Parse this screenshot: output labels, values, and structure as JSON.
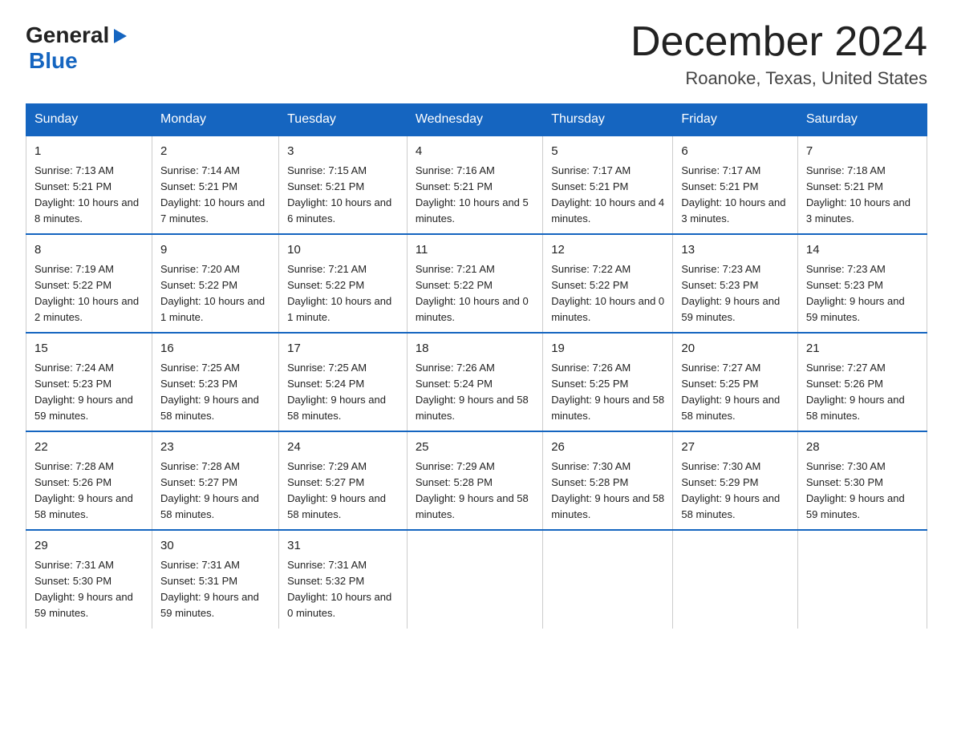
{
  "header": {
    "logo_line1": "General",
    "logo_line2": "Blue",
    "title": "December 2024",
    "subtitle": "Roanoke, Texas, United States"
  },
  "calendar": {
    "days_of_week": [
      "Sunday",
      "Monday",
      "Tuesday",
      "Wednesday",
      "Thursday",
      "Friday",
      "Saturday"
    ],
    "weeks": [
      [
        {
          "day": "1",
          "sunrise": "7:13 AM",
          "sunset": "5:21 PM",
          "daylight": "10 hours and 8 minutes."
        },
        {
          "day": "2",
          "sunrise": "7:14 AM",
          "sunset": "5:21 PM",
          "daylight": "10 hours and 7 minutes."
        },
        {
          "day": "3",
          "sunrise": "7:15 AM",
          "sunset": "5:21 PM",
          "daylight": "10 hours and 6 minutes."
        },
        {
          "day": "4",
          "sunrise": "7:16 AM",
          "sunset": "5:21 PM",
          "daylight": "10 hours and 5 minutes."
        },
        {
          "day": "5",
          "sunrise": "7:17 AM",
          "sunset": "5:21 PM",
          "daylight": "10 hours and 4 minutes."
        },
        {
          "day": "6",
          "sunrise": "7:17 AM",
          "sunset": "5:21 PM",
          "daylight": "10 hours and 3 minutes."
        },
        {
          "day": "7",
          "sunrise": "7:18 AM",
          "sunset": "5:21 PM",
          "daylight": "10 hours and 3 minutes."
        }
      ],
      [
        {
          "day": "8",
          "sunrise": "7:19 AM",
          "sunset": "5:22 PM",
          "daylight": "10 hours and 2 minutes."
        },
        {
          "day": "9",
          "sunrise": "7:20 AM",
          "sunset": "5:22 PM",
          "daylight": "10 hours and 1 minute."
        },
        {
          "day": "10",
          "sunrise": "7:21 AM",
          "sunset": "5:22 PM",
          "daylight": "10 hours and 1 minute."
        },
        {
          "day": "11",
          "sunrise": "7:21 AM",
          "sunset": "5:22 PM",
          "daylight": "10 hours and 0 minutes."
        },
        {
          "day": "12",
          "sunrise": "7:22 AM",
          "sunset": "5:22 PM",
          "daylight": "10 hours and 0 minutes."
        },
        {
          "day": "13",
          "sunrise": "7:23 AM",
          "sunset": "5:23 PM",
          "daylight": "9 hours and 59 minutes."
        },
        {
          "day": "14",
          "sunrise": "7:23 AM",
          "sunset": "5:23 PM",
          "daylight": "9 hours and 59 minutes."
        }
      ],
      [
        {
          "day": "15",
          "sunrise": "7:24 AM",
          "sunset": "5:23 PM",
          "daylight": "9 hours and 59 minutes."
        },
        {
          "day": "16",
          "sunrise": "7:25 AM",
          "sunset": "5:23 PM",
          "daylight": "9 hours and 58 minutes."
        },
        {
          "day": "17",
          "sunrise": "7:25 AM",
          "sunset": "5:24 PM",
          "daylight": "9 hours and 58 minutes."
        },
        {
          "day": "18",
          "sunrise": "7:26 AM",
          "sunset": "5:24 PM",
          "daylight": "9 hours and 58 minutes."
        },
        {
          "day": "19",
          "sunrise": "7:26 AM",
          "sunset": "5:25 PM",
          "daylight": "9 hours and 58 minutes."
        },
        {
          "day": "20",
          "sunrise": "7:27 AM",
          "sunset": "5:25 PM",
          "daylight": "9 hours and 58 minutes."
        },
        {
          "day": "21",
          "sunrise": "7:27 AM",
          "sunset": "5:26 PM",
          "daylight": "9 hours and 58 minutes."
        }
      ],
      [
        {
          "day": "22",
          "sunrise": "7:28 AM",
          "sunset": "5:26 PM",
          "daylight": "9 hours and 58 minutes."
        },
        {
          "day": "23",
          "sunrise": "7:28 AM",
          "sunset": "5:27 PM",
          "daylight": "9 hours and 58 minutes."
        },
        {
          "day": "24",
          "sunrise": "7:29 AM",
          "sunset": "5:27 PM",
          "daylight": "9 hours and 58 minutes."
        },
        {
          "day": "25",
          "sunrise": "7:29 AM",
          "sunset": "5:28 PM",
          "daylight": "9 hours and 58 minutes."
        },
        {
          "day": "26",
          "sunrise": "7:30 AM",
          "sunset": "5:28 PM",
          "daylight": "9 hours and 58 minutes."
        },
        {
          "day": "27",
          "sunrise": "7:30 AM",
          "sunset": "5:29 PM",
          "daylight": "9 hours and 58 minutes."
        },
        {
          "day": "28",
          "sunrise": "7:30 AM",
          "sunset": "5:30 PM",
          "daylight": "9 hours and 59 minutes."
        }
      ],
      [
        {
          "day": "29",
          "sunrise": "7:31 AM",
          "sunset": "5:30 PM",
          "daylight": "9 hours and 59 minutes."
        },
        {
          "day": "30",
          "sunrise": "7:31 AM",
          "sunset": "5:31 PM",
          "daylight": "9 hours and 59 minutes."
        },
        {
          "day": "31",
          "sunrise": "7:31 AM",
          "sunset": "5:32 PM",
          "daylight": "10 hours and 0 minutes."
        },
        null,
        null,
        null,
        null
      ]
    ]
  },
  "labels": {
    "sunrise": "Sunrise:",
    "sunset": "Sunset:",
    "daylight": "Daylight:"
  }
}
